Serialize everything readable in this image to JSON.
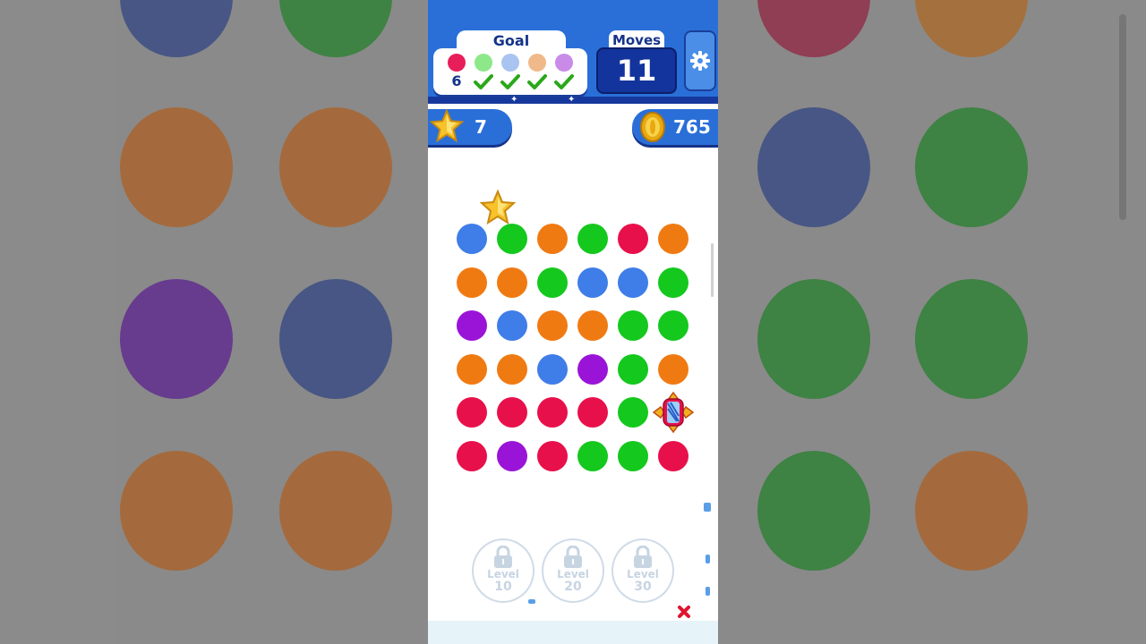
{
  "background_dots": [
    {
      "color": "#1f3b8f"
    },
    {
      "color": "#0f8a1a"
    },
    {
      "color": "#a31038"
    },
    {
      "color": "#c86a10"
    },
    {
      "color": "#c8600e"
    },
    {
      "color": "#c8600e"
    },
    {
      "color": "#1f3b8f"
    },
    {
      "color": "#0f8a1a"
    },
    {
      "color": "#5a0aa0"
    },
    {
      "color": "#1f3b8f"
    },
    {
      "color": "#0f8a1a"
    },
    {
      "color": "#0f8a1a"
    },
    {
      "color": "#c8600e"
    },
    {
      "color": "#c8600e"
    },
    {
      "color": "#0f8a1a"
    },
    {
      "color": "#c8600e"
    }
  ],
  "goal": {
    "title": "Goal",
    "items": [
      {
        "color": "#e81e5a",
        "count": "6",
        "done": false
      },
      {
        "color": "#8de88a",
        "count": "",
        "done": true
      },
      {
        "color": "#a9c4f0",
        "count": "",
        "done": true
      },
      {
        "color": "#f0b98a",
        "count": "",
        "done": true
      },
      {
        "color": "#c98ae8",
        "count": "",
        "done": true
      }
    ]
  },
  "moves": {
    "title": "Moves",
    "value": "11"
  },
  "settings": {
    "icon": "gear-icon"
  },
  "stars": {
    "icon": "star-icon",
    "value": "7"
  },
  "coins": {
    "icon": "coin-icon",
    "value": "765"
  },
  "colors": {
    "blue": "#3f7de8",
    "green": "#14c81e",
    "orange": "#f07a12",
    "red": "#e8104a",
    "purple": "#9a14d8"
  },
  "board": [
    [
      "blue",
      "green",
      "orange",
      "green",
      "red",
      "orange"
    ],
    [
      "orange",
      "orange",
      "green",
      "blue",
      "blue",
      "green"
    ],
    [
      "purple",
      "blue",
      "orange",
      "orange",
      "green",
      "green"
    ],
    [
      "orange",
      "orange",
      "blue",
      "purple",
      "green",
      "orange"
    ],
    [
      "red",
      "red",
      "red",
      "red",
      "green",
      "bomb"
    ],
    [
      "red",
      "purple",
      "red",
      "green",
      "green",
      "red"
    ]
  ],
  "locks": [
    {
      "label": "Level",
      "number": "10"
    },
    {
      "label": "Level",
      "number": "20"
    },
    {
      "label": "Level",
      "number": "30"
    }
  ]
}
